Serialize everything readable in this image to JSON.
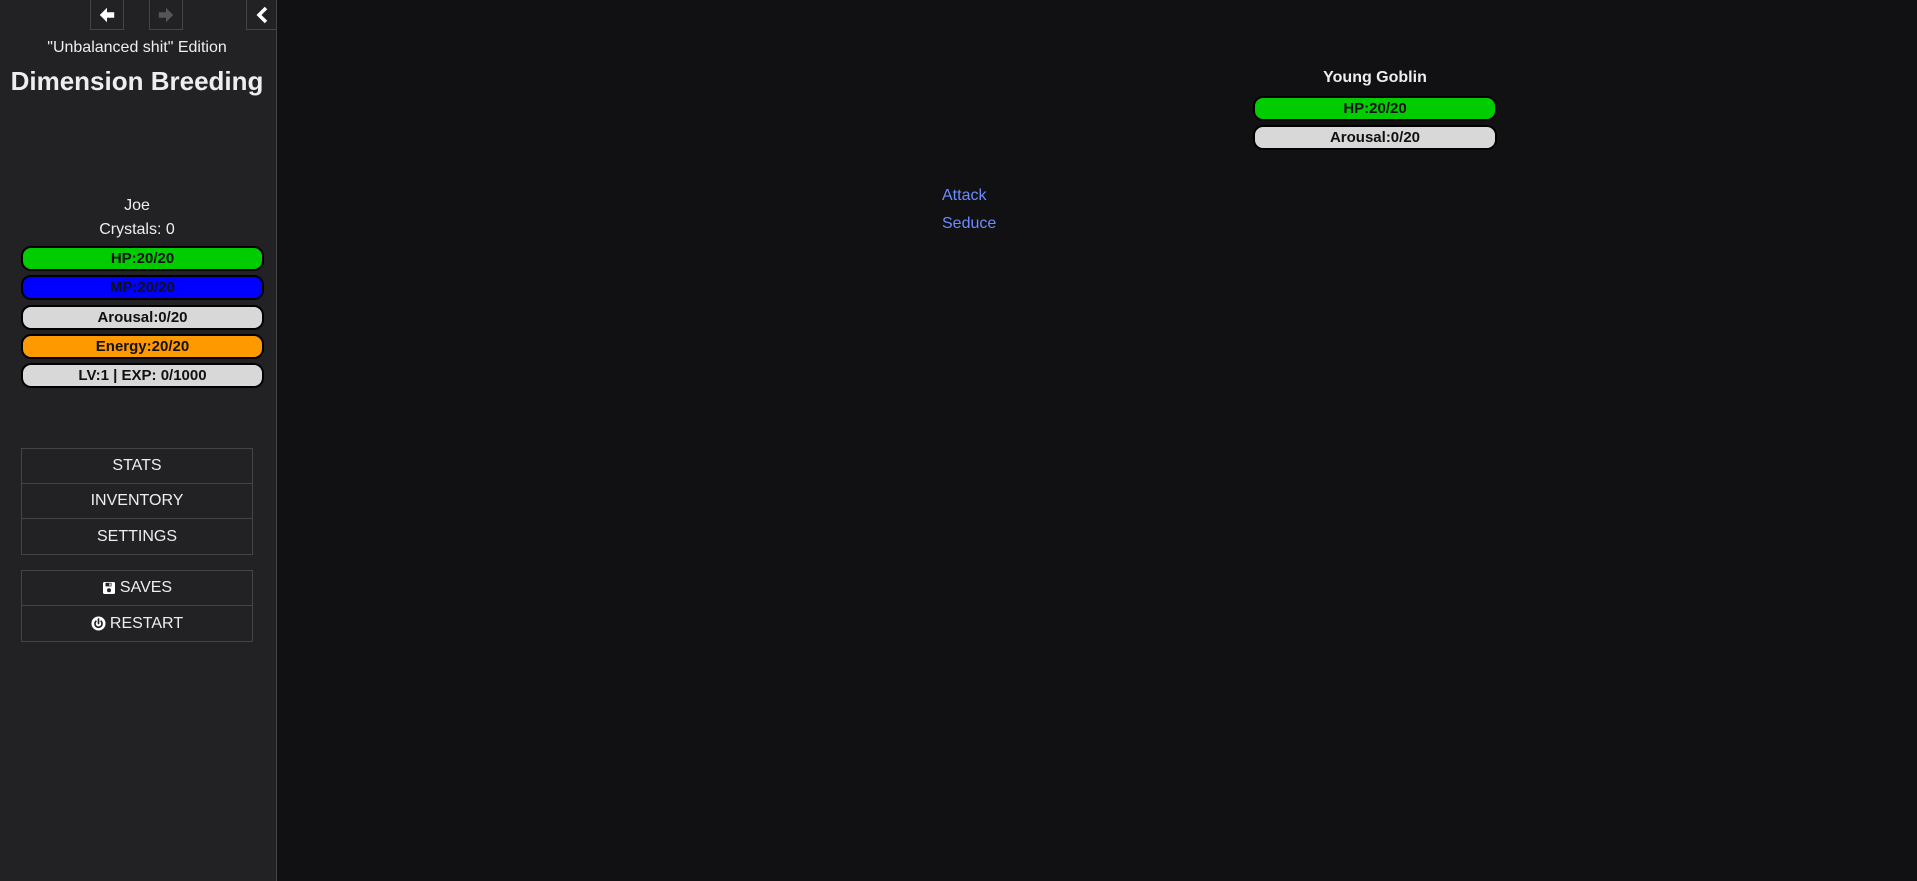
{
  "nav": {
    "back_icon": "arrow-left-icon",
    "forward_icon": "arrow-right-icon",
    "collapse_icon": "chevron-left-icon"
  },
  "story": {
    "subtitle": "\"Unbalanced shit\" Edition",
    "title": "Dimension Breeding"
  },
  "player": {
    "name": "Joe",
    "crystals": "Crystals: 0",
    "hp": "HP:20/20",
    "mp": "MP:20/20",
    "arousal": "Arousal:0/20",
    "energy": "Energy:20/20",
    "level": "LV:1 | EXP: 0/1000"
  },
  "menu": {
    "items": [
      {
        "label": "STATS"
      },
      {
        "label": "INVENTORY"
      },
      {
        "label": "SETTINGS"
      }
    ],
    "saves_label": "SAVES",
    "saves_icon": "floppy-disk-icon",
    "restart_label": "RESTART",
    "restart_icon": "power-icon"
  },
  "enemy": {
    "name": "Young Goblin",
    "hp": "HP:20/20",
    "arousal": "Arousal:0/20"
  },
  "actions": [
    {
      "label": "Attack"
    },
    {
      "label": "Seduce"
    }
  ],
  "colors": {
    "hp": "#00cc00",
    "mp": "#0000ff",
    "arousal": "#d8d8d8",
    "energy": "#ff9900",
    "level": "#d8d8d8",
    "link": "#6b8cff"
  }
}
